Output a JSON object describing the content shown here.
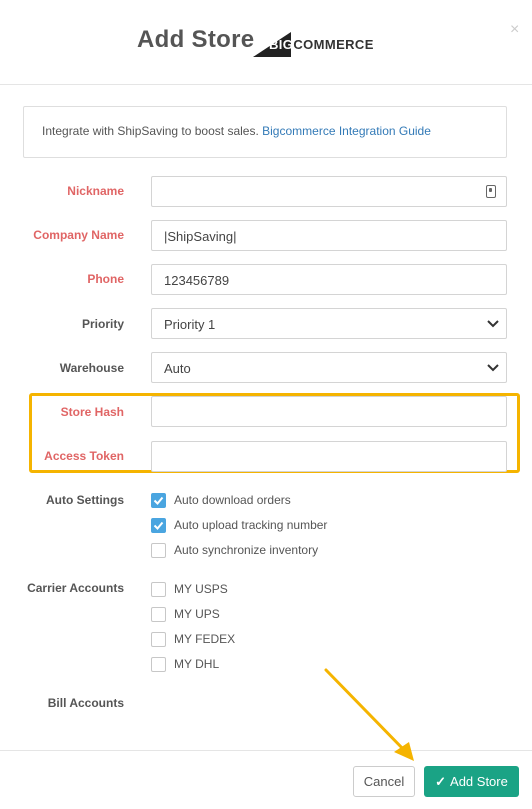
{
  "header": {
    "title": "Add Store",
    "logo_text_part1": "BIG",
    "logo_text_part2": "COMMERCE",
    "close_glyph": "×"
  },
  "info": {
    "text": "Integrate with ShipSaving to boost sales.",
    "link_text": "Bigcommerce Integration Guide"
  },
  "form": {
    "nickname_label": "Nickname",
    "nickname_value": "",
    "company_label": "Company Name",
    "company_value": "|ShipSaving|",
    "phone_label": "Phone",
    "phone_value": "123456789",
    "priority_label": "Priority",
    "priority_value": "Priority 1",
    "warehouse_label": "Warehouse",
    "warehouse_value": "Auto",
    "store_hash_label": "Store Hash",
    "store_hash_value": "",
    "access_token_label": "Access Token",
    "access_token_value": "",
    "auto_settings_label": "Auto Settings",
    "auto_settings": [
      {
        "label": "Auto download orders",
        "checked": true
      },
      {
        "label": "Auto upload tracking number",
        "checked": true
      },
      {
        "label": "Auto synchronize inventory",
        "checked": false
      }
    ],
    "carrier_accounts_label": "Carrier Accounts",
    "carrier_accounts": [
      {
        "label": "MY USPS",
        "checked": false
      },
      {
        "label": "MY UPS",
        "checked": false
      },
      {
        "label": "MY FEDEX",
        "checked": false
      },
      {
        "label": "MY DHL",
        "checked": false
      }
    ],
    "bill_accounts_label": "Bill Accounts"
  },
  "footer": {
    "cancel_label": "Cancel",
    "add_label": "Add Store"
  },
  "colors": {
    "required_label": "#e06565",
    "highlight": "#f5b400",
    "primary_button": "#1aa385",
    "checkbox_checked": "#4aa5e0",
    "link": "#337ab7"
  },
  "icons": [
    "bigcommerce-logo-icon",
    "close-icon",
    "contact-card-icon",
    "chevron-down-icon",
    "check-icon",
    "annotation-arrow-icon"
  ]
}
